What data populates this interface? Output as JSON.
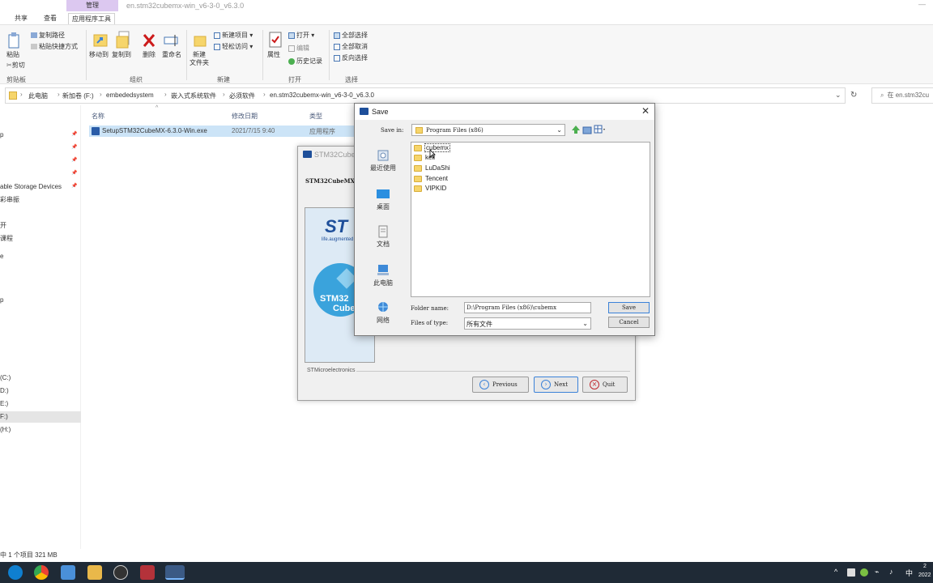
{
  "explorer": {
    "window_title": "en.stm32cubemx-win_v6-3-0_v6.3.0",
    "context_tab": "管理",
    "tabs": [
      "共享",
      "查看",
      "应用程序工具"
    ],
    "ribbon": {
      "pin_label": "粘贴",
      "copy_path": "复制路径",
      "paste_shortcut": "粘贴快捷方式",
      "cut": "剪切",
      "move_to": "移动到",
      "copy_to": "复制到",
      "delete": "删除",
      "rename": "重命名",
      "new_folder_line1": "新建",
      "new_folder_line2": "文件夹",
      "new_item": "新建项目",
      "easy_access": "轻松访问",
      "properties": "属性",
      "open": "打开",
      "edit": "编辑",
      "history": "历史记录",
      "select_all": "全部选择",
      "select_none": "全部取消",
      "invert_selection": "反向选择",
      "groups": [
        "剪贴板",
        "组织",
        "新建",
        "打开",
        "选择"
      ]
    },
    "breadcrumb": [
      "此电脑",
      "新加卷 (F:)",
      "embededsystem",
      "嵌入式系统软件",
      "必须软件",
      "en.stm32cubemx-win_v6-3-0_v6.3.0"
    ],
    "search_placeholder": "在 en.stm32cu",
    "columns": {
      "name": "名称",
      "date": "修改日期",
      "type": "类型"
    },
    "file": {
      "name": "SetupSTM32CubeMX-6.3.0-Win.exe",
      "date": "2021/7/15 9:40",
      "type": "应用程序"
    },
    "nav_items": [
      {
        "label": "p",
        "pinned": true
      },
      {
        "label": "",
        "pinned": true
      },
      {
        "label": "",
        "pinned": true
      },
      {
        "label": "",
        "pinned": true
      },
      {
        "label": "able Storage Devices",
        "pinned": true
      },
      {
        "label": "彩串振",
        "pinned": false
      },
      {
        "label": "",
        "pinned": false
      },
      {
        "label": "开",
        "pinned": false
      },
      {
        "label": "课程",
        "pinned": false
      },
      {
        "label": "e",
        "pinned": false
      },
      {
        "label": "",
        "pinned": false
      },
      {
        "label": "",
        "pinned": false
      },
      {
        "label": "p",
        "pinned": false
      },
      {
        "label": "",
        "pinned": false
      },
      {
        "label": "",
        "pinned": false
      },
      {
        "label": "",
        "pinned": false
      },
      {
        "label": "",
        "pinned": false
      },
      {
        "label": "(C:)",
        "pinned": false
      },
      {
        "label": "D:)",
        "pinned": false
      },
      {
        "label": "E:)",
        "pinned": false
      },
      {
        "label": "F:)",
        "pinned": false
      },
      {
        "label": "(H:)",
        "pinned": false
      }
    ],
    "status": "中 1 个项目  321 MB"
  },
  "installer": {
    "title": "STM32CubeM",
    "subtitle": "STM32CubeMX Ins",
    "logo_text": "ST",
    "tagline": "life.augmented",
    "cube_text1": "STM32",
    "cube_text2": "Cube",
    "footer": "STMicroelectronics",
    "btn_previous": "Previous",
    "btn_next": "Next",
    "btn_quit": "Quit"
  },
  "save_dialog": {
    "title": "Save",
    "save_in_label": "Save in:",
    "save_in_value": "Program Files (x86)",
    "places": [
      "最近使用",
      "桌面",
      "文档",
      "此电脑",
      "网络"
    ],
    "folders": [
      "cubemx",
      "keil",
      "LuDaShi",
      "Tencent",
      "VIPKID"
    ],
    "folder_name_label": "Folder name:",
    "folder_name_value": "D:\\Program Files (x86)\\cubemx",
    "files_of_type_label": "Files of type:",
    "files_of_type_value": "所有文件",
    "save_button": "Save",
    "cancel_button": "Cancel"
  },
  "taskbar": {
    "ime": "中",
    "clock_top": "2",
    "clock_bottom": "2022"
  },
  "colors": {
    "accent": "#3b82d8",
    "taskbar": "#1f2a36",
    "selection": "#cce4f7"
  }
}
